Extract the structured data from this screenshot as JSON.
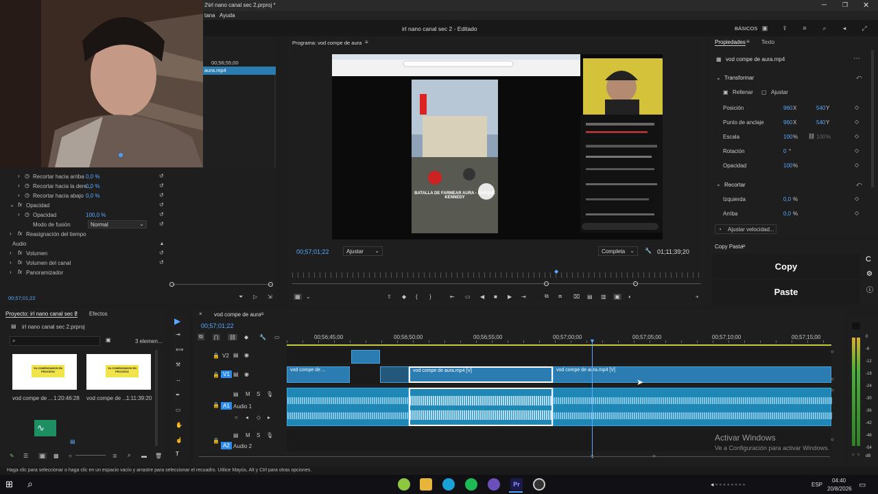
{
  "window": {
    "title": "2\\irl nano canal sec 2.prproj *",
    "menu": [
      "tana",
      "Ayuda"
    ],
    "workspace_title": "irl nano canal sec 2 - Editado",
    "workspace_label": "BÁSICOS"
  },
  "source_panel": {
    "timecode": "00;56;55;00",
    "clip_label": "aura.mp4"
  },
  "effects": {
    "rows": [
      {
        "label": "Recortar hacia arriba",
        "value": "0,0 %"
      },
      {
        "label": "Recortar hacia la dere...",
        "value": "0,0 %"
      },
      {
        "label": "Recortar hacia abajo",
        "value": "0,0 %"
      },
      {
        "label": "Opacidad",
        "value": ""
      },
      {
        "label": "Opacidad",
        "value": "100,0 %"
      },
      {
        "label": "Modo de fusión",
        "value": "Normal"
      },
      {
        "label": "Reasignación del tiempo",
        "value": ""
      },
      {
        "label": "Audio",
        "value": ""
      },
      {
        "label": "Volumen",
        "value": ""
      },
      {
        "label": "Volumen del canal",
        "value": ""
      },
      {
        "label": "Panoramizador",
        "value": ""
      }
    ],
    "timecode": "00;57;01;22"
  },
  "program": {
    "title": "Programa: vod compe de aura",
    "timecode": "00;57;01;22",
    "fit": "Ajustar",
    "quality": "Completa",
    "duration": "01;11;39;20",
    "video_caption": "BATALLA DE FARMEAR AURA - PARQUE KENNEDY"
  },
  "properties": {
    "tab_active": "Propiedades",
    "tab_other": "Texto",
    "file": "vod compe de aura.mp4",
    "section_transform": "Transformar",
    "fill": "Rellenar",
    "fit": "Ajustar",
    "rows": [
      {
        "label": "Posición",
        "v1": "960",
        "u1": "X",
        "v2": "540",
        "u2": "Y"
      },
      {
        "label": "Punto de anclaje",
        "v1": "960",
        "u1": "X",
        "v2": "540",
        "u2": "Y"
      },
      {
        "label": "Escala",
        "v1": "100",
        "u1": "%",
        "v2": "100",
        "u2": "%"
      },
      {
        "label": "Rotación",
        "v1": "0",
        "u1": "°",
        "v2": "",
        "u2": ""
      },
      {
        "label": "Opacidad",
        "v1": "100",
        "u1": "%",
        "v2": "",
        "u2": ""
      }
    ],
    "section_crop": "Recortar",
    "crop_rows": [
      {
        "label": "Izquierda",
        "v1": "0,0",
        "u1": "%"
      },
      {
        "label": "Arriba",
        "v1": "0,0",
        "u1": "%"
      }
    ],
    "speed_button": "Ajustar velocidad..."
  },
  "copypaste": {
    "title": "Copy Pasta",
    "copy": "Copy",
    "paste": "Paste"
  },
  "project": {
    "tab_active": "Proyecto: irl nano canal sec 2",
    "tab_other": "Efectos",
    "file": "irl nano canal sec 2.prproj",
    "count": "3 elemen...",
    "items": [
      {
        "name": "vod compe de ...",
        "duration": "1:20:46:28",
        "thumb_text": "YA COMENZAMOS EN PROCESO"
      },
      {
        "name": "vod compe de ...",
        "duration": "1:11:39:20",
        "thumb_text": "YA COMENZAMOS EN PROCESO"
      }
    ]
  },
  "timeline": {
    "sequence": "vod compe de aura",
    "timecode": "00;57;01;22",
    "ruler": [
      "00;56;45;00",
      "00;56;50;00",
      "00;56;55;00",
      "00;57;00;00",
      "00;57;05;00",
      "00;57;10;00",
      "00;57;15;00"
    ],
    "tracks": [
      {
        "id": "V2",
        "name": ""
      },
      {
        "id": "V1",
        "name": ""
      },
      {
        "id": "A1",
        "name": "Audio 1"
      },
      {
        "id": "A2",
        "name": "Audio 2"
      }
    ],
    "clips": [
      "vod compe de ...",
      "vod compe de aura.mp4 [V]",
      "vod compe de aura.mp4 [V]"
    ]
  },
  "meters": {
    "scale": [
      "0",
      "-6",
      "-12",
      "-18",
      "-24",
      "-30",
      "-36",
      "-42",
      "-48",
      "-54",
      "dB"
    ]
  },
  "watermark": {
    "title": "Activar Windows",
    "subtitle": "Ve a Configuración para activar Windows."
  },
  "status": {
    "text": "Haga clic para seleccionar o haga clic en un espacio vacío y arrastre para seleccionar el recuadro. Utilice Mayús, Alt y Ctrl para otras opciones."
  },
  "taskbar": {
    "lang": "ESP",
    "time": "04:40",
    "date": "20/8/2026"
  },
  "colors": {
    "accent": "#2d8ceb",
    "clip_video": "#2b7cb1",
    "clip_audio": "#1f87b5",
    "playhead": "#5aa9ff"
  }
}
